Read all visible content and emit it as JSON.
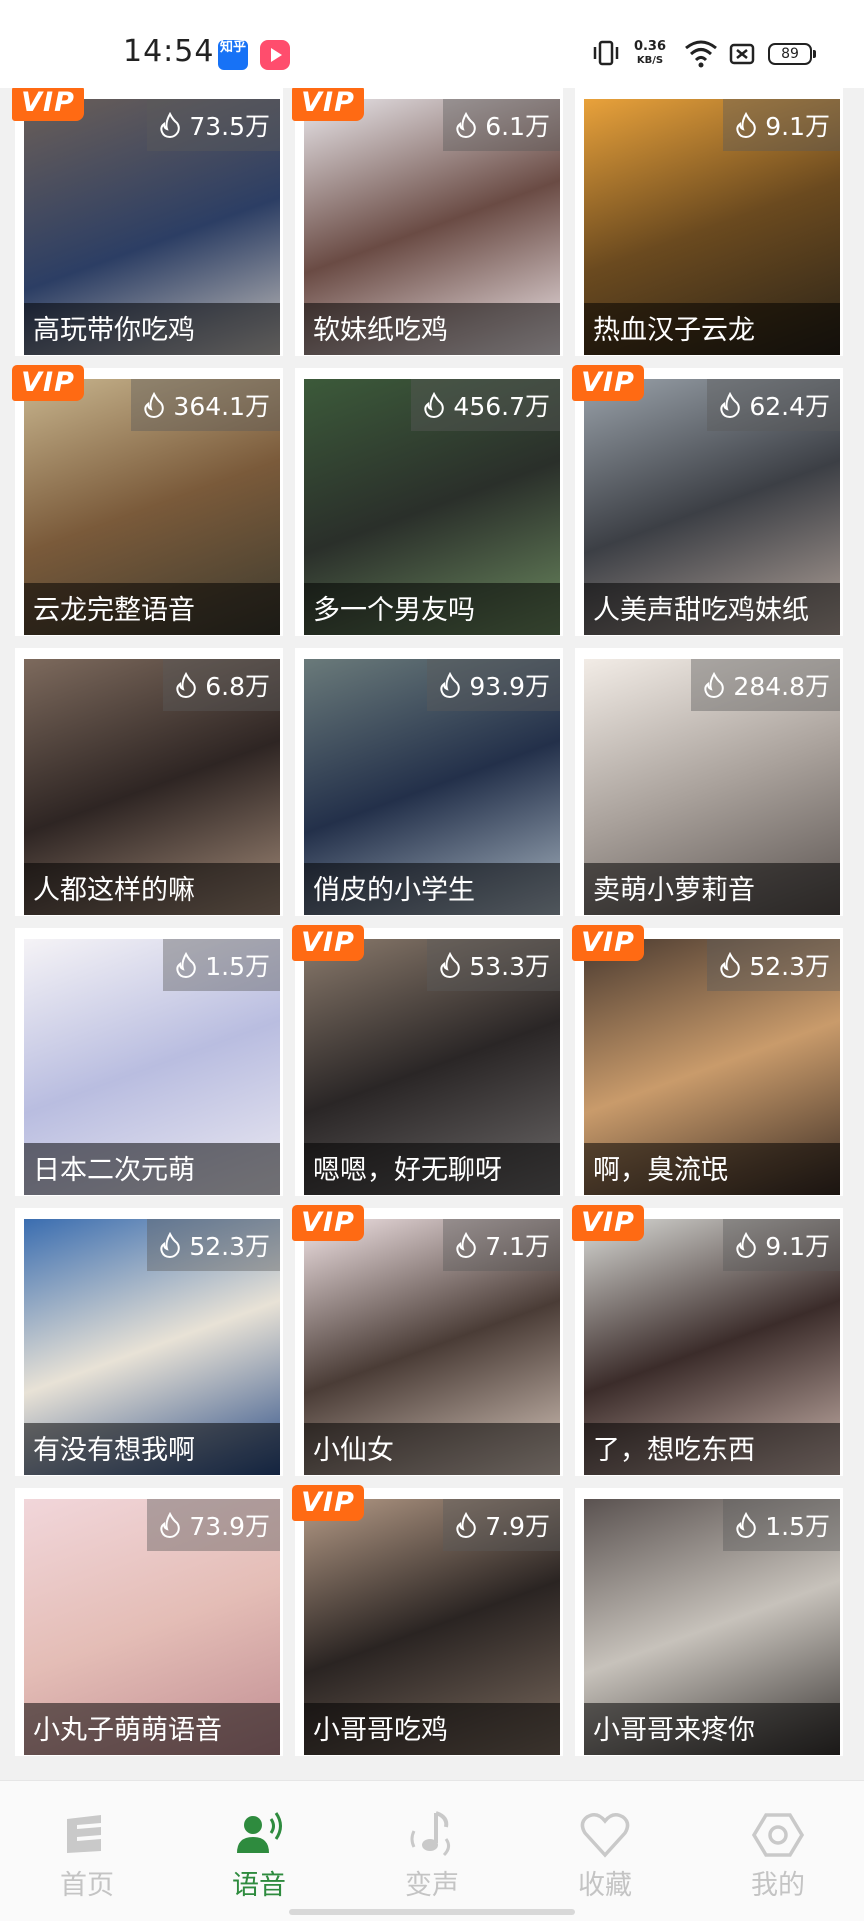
{
  "status_bar": {
    "time": "14:54",
    "net_speed_value": "0.36",
    "net_speed_unit": "KB/S",
    "battery_level": "89",
    "notification_icons": [
      "zhihu-app-icon",
      "play-app-icon"
    ],
    "status_icons": [
      "vibrate-icon",
      "wifi-icon",
      "sim-icon",
      "battery-icon"
    ]
  },
  "colors": {
    "vip": "#ff6a13",
    "active_tab": "#2e8b3e",
    "inactive_tab": "#c4c4c4"
  },
  "voice_packs": [
    {
      "title": "高玩带你吃鸡",
      "heat": "73.5万",
      "vip": true
    },
    {
      "title": "软妹纸吃鸡",
      "heat": "6.1万",
      "vip": true
    },
    {
      "title": "热血汉子云龙",
      "heat": "9.1万",
      "vip": false
    },
    {
      "title": "云龙完整语音",
      "heat": "364.1万",
      "vip": true
    },
    {
      "title": "多一个男友吗",
      "heat": "456.7万",
      "vip": false
    },
    {
      "title": "人美声甜吃鸡妹纸",
      "heat": "62.4万",
      "vip": true
    },
    {
      "title": "人都这样的嘛",
      "heat": "6.8万",
      "vip": false
    },
    {
      "title": "俏皮的小学生",
      "heat": "93.9万",
      "vip": false
    },
    {
      "title": "卖萌小萝莉音",
      "heat": "284.8万",
      "vip": false
    },
    {
      "title": "日本二次元萌",
      "heat": "1.5万",
      "vip": false
    },
    {
      "title": "嗯嗯，好无聊呀",
      "heat": "53.3万",
      "vip": true
    },
    {
      "title": "啊，臭流氓",
      "heat": "52.3万",
      "vip": true
    },
    {
      "title": "有没有想我啊",
      "heat": "52.3万",
      "vip": false
    },
    {
      "title": "小仙女",
      "heat": "7.1万",
      "vip": true
    },
    {
      "title": "了，想吃东西",
      "heat": "9.1万",
      "vip": true
    },
    {
      "title": "小丸子萌萌语音",
      "heat": "73.9万",
      "vip": false
    },
    {
      "title": "小哥哥吃鸡",
      "heat": "7.9万",
      "vip": true
    },
    {
      "title": "小哥哥来疼你",
      "heat": "1.5万",
      "vip": false
    }
  ],
  "vip_label": "VIP",
  "tabs": [
    {
      "label": "首页",
      "icon": "home-icon",
      "active": false
    },
    {
      "label": "语音",
      "icon": "voice-icon",
      "active": true
    },
    {
      "label": "变声",
      "icon": "voice-changer-icon",
      "active": false
    },
    {
      "label": "收藏",
      "icon": "heart-icon",
      "active": false
    },
    {
      "label": "我的",
      "icon": "profile-hexagon-icon",
      "active": false
    }
  ]
}
